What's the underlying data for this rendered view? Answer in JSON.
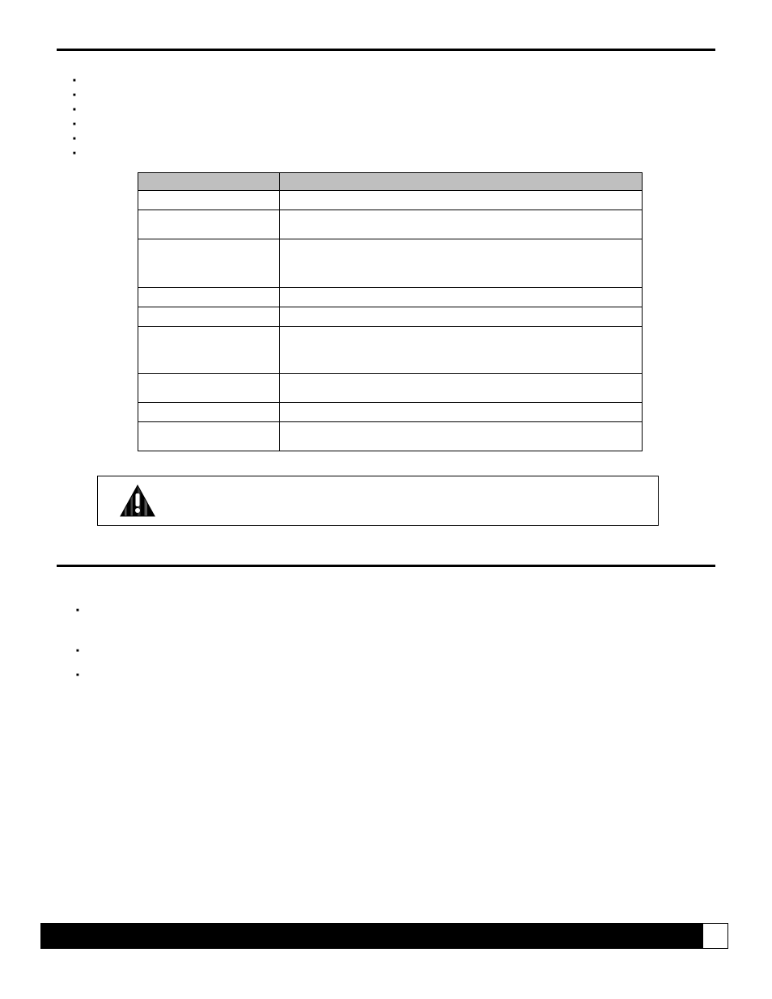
{
  "section1": {
    "bullets": [
      "",
      "",
      "",
      "",
      "",
      ""
    ]
  },
  "table": {
    "headers": {
      "label": "",
      "desc": ""
    },
    "rows": [
      {
        "label": "",
        "desc": ""
      },
      {
        "label": "",
        "desc": ""
      },
      {
        "label": "",
        "desc": ""
      },
      {
        "label": "",
        "desc": ""
      },
      {
        "label": "",
        "desc": ""
      },
      {
        "label": "",
        "desc": ""
      },
      {
        "label": "",
        "desc": ""
      },
      {
        "label": "",
        "desc": ""
      },
      {
        "label": "",
        "desc": ""
      }
    ]
  },
  "callout": {
    "text": ""
  },
  "section2": {
    "intro": "",
    "bullets": [
      "",
      "",
      ""
    ]
  },
  "footer": {
    "page": ""
  }
}
